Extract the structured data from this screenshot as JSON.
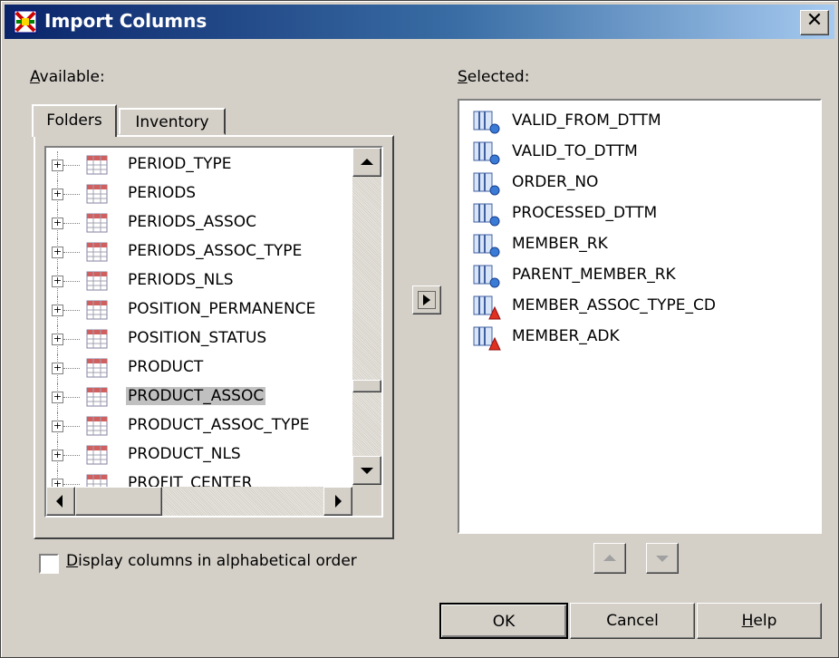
{
  "window": {
    "title": "Import Columns",
    "close_glyph": "✕"
  },
  "available": {
    "label_access": "A",
    "label_rest": "vailable:"
  },
  "selected": {
    "label_access": "S",
    "label_rest": "elected:"
  },
  "tabs": [
    {
      "label": "Folders",
      "active": true
    },
    {
      "label": "Inventory",
      "active": false
    }
  ],
  "tree": {
    "items": [
      {
        "label": "PERIOD_TYPE"
      },
      {
        "label": "PERIODS"
      },
      {
        "label": "PERIODS_ASSOC"
      },
      {
        "label": "PERIODS_ASSOC_TYPE"
      },
      {
        "label": "PERIODS_NLS"
      },
      {
        "label": "POSITION_PERMANENCE"
      },
      {
        "label": "POSITION_STATUS"
      },
      {
        "label": "PRODUCT"
      },
      {
        "label": "PRODUCT_ASSOC",
        "selected": true
      },
      {
        "label": "PRODUCT_ASSOC_TYPE"
      },
      {
        "label": "PRODUCT_NLS"
      },
      {
        "label": "PROFIT_CENTER"
      }
    ]
  },
  "selected_columns": [
    {
      "label": "VALID_FROM_DTTM",
      "icon": "column-numeric-icon"
    },
    {
      "label": "VALID_TO_DTTM",
      "icon": "column-numeric-icon"
    },
    {
      "label": "ORDER_NO",
      "icon": "column-numeric-icon"
    },
    {
      "label": "PROCESSED_DTTM",
      "icon": "column-numeric-icon"
    },
    {
      "label": "MEMBER_RK",
      "icon": "column-numeric-icon"
    },
    {
      "label": "PARENT_MEMBER_RK",
      "icon": "column-numeric-icon"
    },
    {
      "label": "MEMBER_ASSOC_TYPE_CD",
      "icon": "column-character-icon"
    },
    {
      "label": "MEMBER_ADK",
      "icon": "column-character-icon"
    }
  ],
  "checkbox": {
    "access": "D",
    "rest": "isplay columns in alphabetical order",
    "checked": false
  },
  "buttons": {
    "ok": "OK",
    "cancel": "Cancel",
    "help_access": "H",
    "help_rest": "elp"
  },
  "colors": {
    "titlebar_start": "#0a246a",
    "titlebar_end": "#a6caf0",
    "dialog_bg": "#d4d0c8",
    "selection": "#c0c0c0"
  }
}
